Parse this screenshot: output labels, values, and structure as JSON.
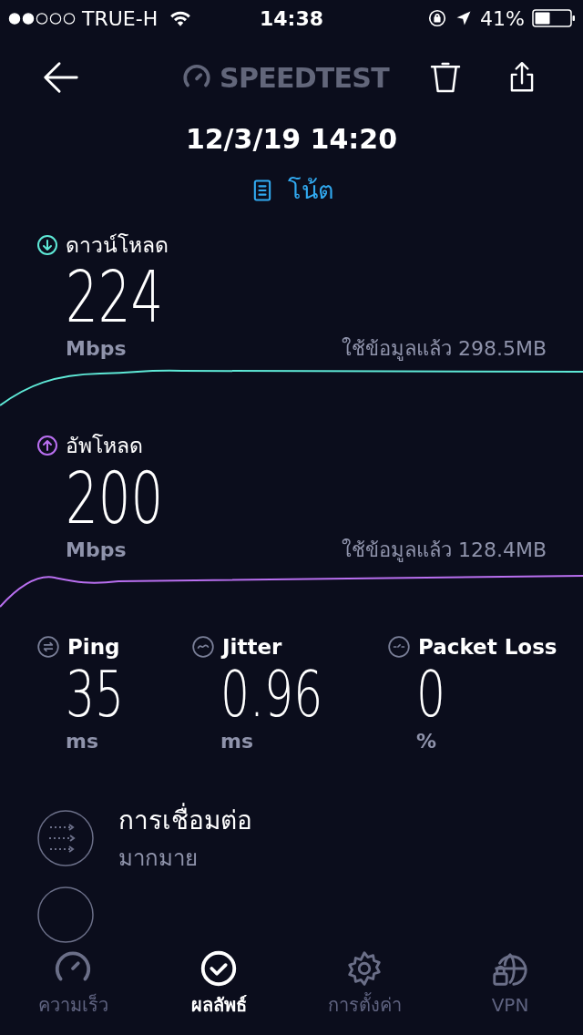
{
  "status_bar": {
    "carrier": "TRUE-H",
    "time": "14:38",
    "battery": "41%"
  },
  "header": {
    "logo": "SPEEDTEST",
    "date": "12/3/19 14:20",
    "note": "โน้ต"
  },
  "speeds": [
    {
      "kind": "download",
      "label": "ดาวน์โหลด",
      "value": "224",
      "unit": "Mbps",
      "data_used": "ใช้ข้อมูลแล้ว 298.5MB",
      "color": "#5ee8d6"
    },
    {
      "kind": "upload",
      "label": "อัพโหลด",
      "value": "200",
      "unit": "Mbps",
      "data_used": "ใช้ข้อมูลแล้ว 128.4MB",
      "color": "#b96ff0"
    }
  ],
  "metrics": [
    {
      "kind": "ping",
      "label": "Ping",
      "value": "35",
      "unit": "ms"
    },
    {
      "kind": "jitter",
      "label": "Jitter",
      "value": "0.96",
      "unit": "ms"
    },
    {
      "kind": "loss",
      "label": "Packet Loss",
      "value": "0",
      "unit": "%"
    }
  ],
  "details": [
    {
      "title": "การเชื่อมต่อ",
      "subtitle": "มากมาย"
    }
  ],
  "tabs": [
    {
      "kind": "speed",
      "label": "ความเร็ว",
      "selected": false
    },
    {
      "kind": "results",
      "label": "ผลลัพธ์",
      "selected": true
    },
    {
      "kind": "settings",
      "label": "การตั้งค่า",
      "selected": false
    },
    {
      "kind": "vpn",
      "label": "VPN",
      "selected": false
    }
  ]
}
